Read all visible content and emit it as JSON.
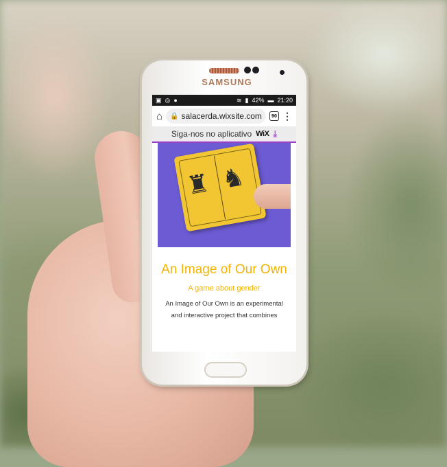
{
  "device": {
    "brand": "SAMSUNG"
  },
  "status_bar": {
    "battery": "42%",
    "time": "21:20"
  },
  "browser": {
    "url": "salacerda.wixsite.com",
    "tab_count": "90"
  },
  "wix_banner": {
    "text": "Siga-nos no aplicativo",
    "logo": "WiX"
  },
  "page": {
    "title": "An Image of Our Own",
    "subtitle": "A game about gender",
    "body_line_1": "An Image of Our Own is an experimental",
    "body_line_2": "and interactive project that combines"
  },
  "icons": [
    "home-icon",
    "lock-icon",
    "menu-dots-icon",
    "download-icon",
    "wifi-icon",
    "signal-icon",
    "battery-icon"
  ],
  "colors": {
    "accent_title": "#f2b400",
    "hero_bg": "#6c5bd3",
    "card": "#f2c633",
    "wix_accent": "#9b3fc6"
  }
}
